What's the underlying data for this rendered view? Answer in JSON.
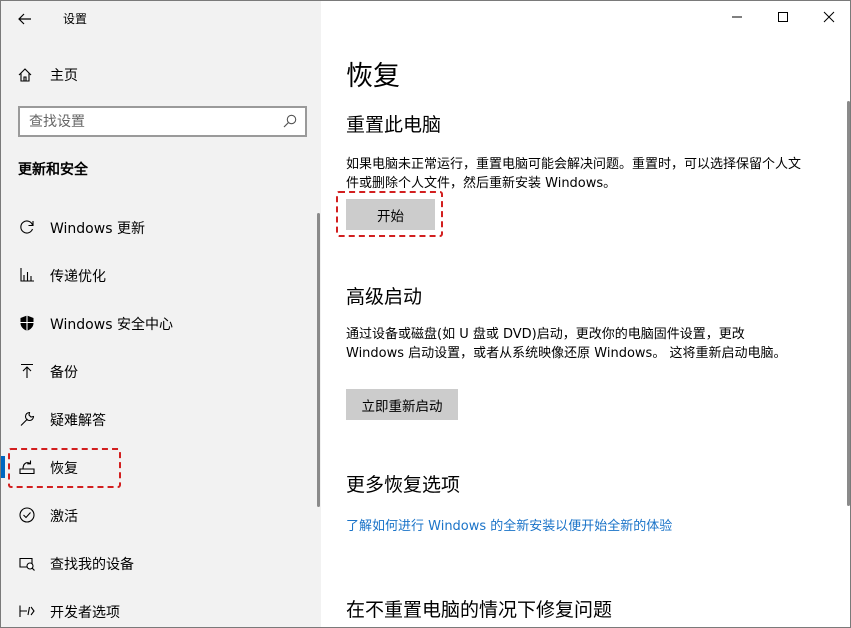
{
  "window": {
    "title": "设置"
  },
  "sidebar": {
    "home_label": "主页",
    "search_placeholder": "查找设置",
    "section_title": "更新和安全",
    "items": [
      {
        "label": "Windows 更新",
        "icon": "refresh-icon"
      },
      {
        "label": "传递优化",
        "icon": "delivery-optimization-icon"
      },
      {
        "label": "Windows 安全中心",
        "icon": "shield-icon"
      },
      {
        "label": "备份",
        "icon": "upload-arrow-icon"
      },
      {
        "label": "疑难解答",
        "icon": "wrench-icon"
      },
      {
        "label": "恢复",
        "icon": "recovery-icon",
        "active": true
      },
      {
        "label": "激活",
        "icon": "check-circle-icon"
      },
      {
        "label": "查找我的设备",
        "icon": "find-device-icon"
      },
      {
        "label": "开发者选项",
        "icon": "developer-icon"
      }
    ]
  },
  "main": {
    "title": "恢复",
    "reset": {
      "heading": "重置此电脑",
      "description": "如果电脑未正常运行，重置电脑可能会解决问题。重置时，可以选择保留个人文件或删除个人文件，然后重新安装 Windows。",
      "button": "开始"
    },
    "advanced": {
      "heading": "高级启动",
      "description": "通过设备或磁盘(如 U 盘或 DVD)启动，更改你的电脑固件设置，更改 Windows 启动设置，或者从系统映像还原 Windows。 这将重新启动电脑。",
      "button": "立即重新启动"
    },
    "more": {
      "heading": "更多恢复选项",
      "link": "了解如何进行 Windows 的全新安装以便开始全新的体验"
    },
    "fix": {
      "heading": "在不重置电脑的情况下修复问题"
    }
  },
  "colors": {
    "accent": "#0067c0",
    "link": "#1a73c8",
    "highlight": "#d21f1f",
    "sidebar_bg": "#f2f2f2",
    "button_bg": "#cccccc"
  }
}
